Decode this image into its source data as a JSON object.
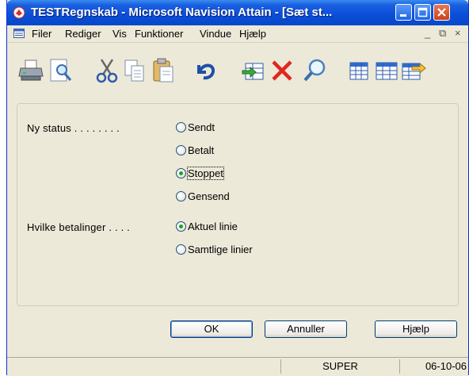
{
  "window": {
    "title": "TESTRegnskab - Microsoft Navision Attain - [Sæt st...",
    "title_bar_color": "#0a4ed8"
  },
  "menu": {
    "items": [
      "Filer",
      "Rediger",
      "Vis",
      "Funktioner",
      "Vindue",
      "Hjælp"
    ],
    "mdi_controls": [
      "_",
      "⧉",
      "×"
    ]
  },
  "toolbar": {
    "icons": [
      "print-icon",
      "print-preview-icon",
      "cut-icon",
      "copy-icon",
      "paste-icon",
      "undo-icon",
      "insert-record-icon",
      "delete-icon",
      "find-icon",
      "table-icon",
      "table-card-icon",
      "table-export-icon"
    ]
  },
  "form": {
    "status_label": "Ny status . . . . . . . .",
    "status_options": [
      "Sendt",
      "Betalt",
      "Stoppet",
      "Gensend"
    ],
    "status_selected": "Stoppet",
    "payments_label": "Hvilke betalinger . . . .",
    "payments_options": [
      "Aktuel linie",
      "Samtlige linier"
    ],
    "payments_selected": "Aktuel linie"
  },
  "buttons": {
    "ok": "OK",
    "cancel": "Annuller",
    "help": "Hjælp"
  },
  "statusbar": {
    "user": "SUPER",
    "date": "06-10-06"
  }
}
